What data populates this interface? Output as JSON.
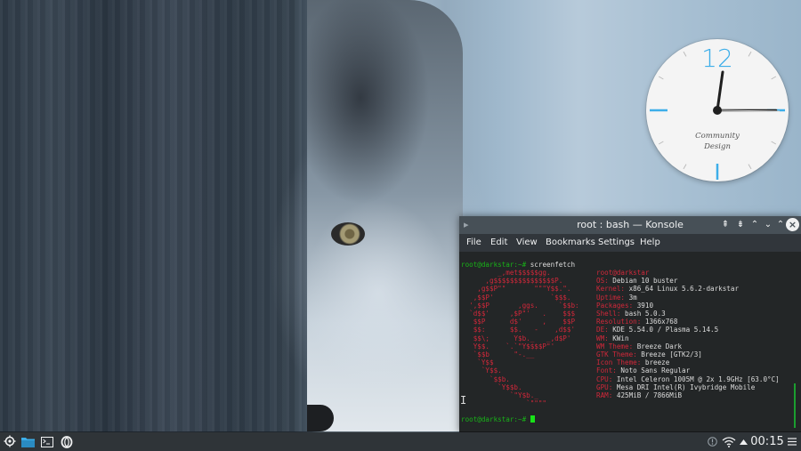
{
  "desktop": {
    "wallpaper": "wolf-behind-tree"
  },
  "clock_widget": {
    "twelve_label": "12",
    "brand_line1": "Community",
    "brand_line2": "Design",
    "accent_color": "#3daee9",
    "time": "00:15"
  },
  "window": {
    "title": "root : bash — Konsole",
    "buttons": [
      "keep-above-icon",
      "keep-below-icon",
      "maximize-icon",
      "minimize-icon",
      "maximize-icon",
      "close-icon"
    ],
    "menu": [
      "File",
      "Edit",
      "View",
      "Bookmarks",
      "Settings",
      "Help"
    ]
  },
  "terminal": {
    "prompt": "root@darkstar:~#",
    "command": " screenfetch",
    "logo": [
      "         _,met$$$$$gg.",
      "      ,g$$$$$$$$$$$$$$$P.",
      "    ,g$$P\"\"       \"\"\"Y$$.\".",
      "   ,$$P'              `$$$.",
      "  ',$$P       ,ggs.     `$$b:",
      "  `d$$'     ,$P\"'   .    $$$",
      "   $$P      d$'     ,    $$P",
      "   $$:      $$.   -    ,d$$'",
      "   $$\\;      Y$b._   _,d$P'",
      "   Y$$.    `.`\"Y$$$$P\"'",
      "   `$$b      \"-.__",
      "    `Y$$",
      "     `Y$$.",
      "       `$$b.",
      "         `Y$$b.",
      "            `\"Y$b._",
      "                `\"\"\"\""
    ],
    "user_host": "root@darkstar",
    "info": [
      {
        "key": "OS:",
        "value": " Debian 10 buster"
      },
      {
        "key": "Kernel:",
        "value": " x86_64 Linux 5.6.2-darkstar"
      },
      {
        "key": "Uptime:",
        "value": " 3m"
      },
      {
        "key": "Packages:",
        "value": " 3910"
      },
      {
        "key": "Shell:",
        "value": " bash 5.0.3"
      },
      {
        "key": "Resolution:",
        "value": " 1366x768"
      },
      {
        "key": "DE:",
        "value": " KDE 5.54.0 / Plasma 5.14.5"
      },
      {
        "key": "WM:",
        "value": " KWin"
      },
      {
        "key": "WM Theme:",
        "value": " Breeze Dark"
      },
      {
        "key": "GTK Theme:",
        "value": " Breeze [GTK2/3]"
      },
      {
        "key": "Icon Theme:",
        "value": " breeze"
      },
      {
        "key": "Font:",
        "value": " Noto Sans Regular"
      },
      {
        "key": "CPU:",
        "value": " Intel Celeron 1005M @ 2x 1.9GHz [63.0°C]"
      },
      {
        "key": "GPU:",
        "value": " Mesa DRI Intel(R) Ivybridge Mobile"
      },
      {
        "key": "RAM:",
        "value": " 425MiB / 7866MiB"
      }
    ],
    "colors": {
      "prompt": "#18b218",
      "accent": "#d0283a",
      "text": "#dcdcdc",
      "bg": "#232627"
    }
  },
  "panel": {
    "launchers": [
      "kde-menu-icon",
      "file-manager-icon",
      "terminal-icon",
      "opera-browser-icon"
    ],
    "tray": [
      "notifications-icon",
      "network-wifi-icon",
      "show-hidden-arrow-icon"
    ],
    "clock": "00:15",
    "menu_icon": "panel-menu-icon"
  }
}
